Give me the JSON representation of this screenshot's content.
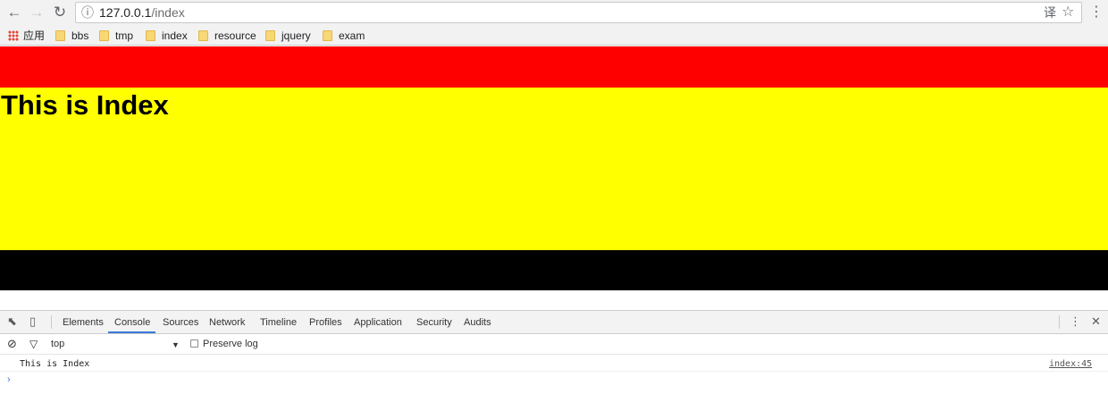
{
  "browser": {
    "url_host": "127.0.0.1",
    "url_path": "/index",
    "info_glyph": "ⓘ",
    "nav": {
      "back": "←",
      "forward": "→",
      "reload": "↻"
    },
    "translate_glyph": "译",
    "star_glyph": "☆",
    "menu_glyph": "⋮"
  },
  "bookmarks": [
    {
      "label": "应用",
      "type": "apps"
    },
    {
      "label": "bbs",
      "type": "folder"
    },
    {
      "label": "tmp",
      "type": "folder"
    },
    {
      "label": "index",
      "type": "folder"
    },
    {
      "label": "resource",
      "type": "folder"
    },
    {
      "label": "jquery",
      "type": "folder"
    },
    {
      "label": "exam",
      "type": "folder"
    }
  ],
  "page": {
    "heading": "This is Index",
    "colors": {
      "top": "#ff0000",
      "middle": "#ffff00",
      "bottom": "#000000"
    }
  },
  "devtools": {
    "tabs": [
      "Elements",
      "Console",
      "Sources",
      "Network",
      "Timeline",
      "Profiles",
      "Application",
      "Security",
      "Audits"
    ],
    "active_tab": "Console",
    "icons": {
      "inspect": "⬉",
      "device": "▯",
      "more": "⋮",
      "close": "✕",
      "clear": "⊘",
      "filter": "▽",
      "dropdown": "▼"
    },
    "context": "top",
    "preserve_log": "Preserve log",
    "console_message": "This is Index",
    "console_source": "index:45",
    "prompt": "›"
  }
}
